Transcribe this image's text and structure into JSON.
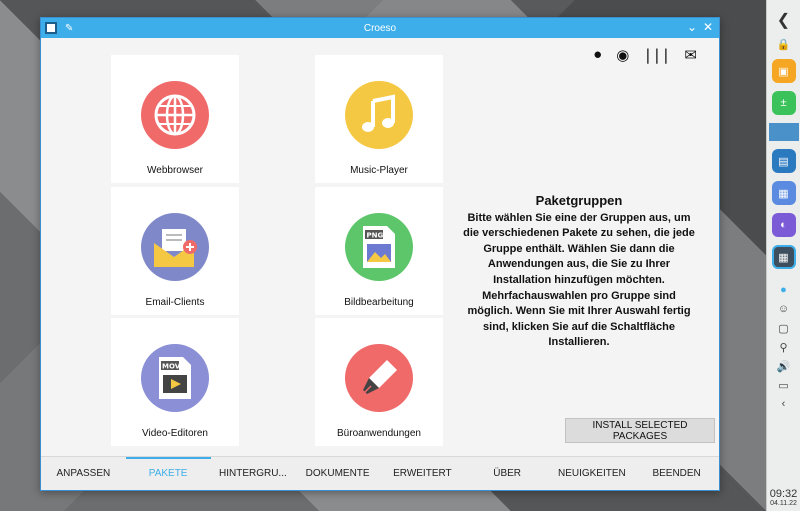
{
  "window": {
    "title": "Croeso"
  },
  "header_icons": [
    "github-icon",
    "chat-icon",
    "kde-icon",
    "mail-icon"
  ],
  "tiles": [
    {
      "label": "Webbrowser",
      "icon": "globe-icon",
      "color": "#f06a6a"
    },
    {
      "label": "Music-Player",
      "icon": "music-note-icon",
      "color": "#f4c842"
    },
    {
      "label": "Email-Clients",
      "icon": "email-envelope-icon",
      "color": "#7f89c9"
    },
    {
      "label": "Bildbearbeitung",
      "icon": "png-file-icon",
      "color": "#5dc66b"
    },
    {
      "label": "Video-Editoren",
      "icon": "mov-file-icon",
      "color": "#8a8fd6"
    },
    {
      "label": "Büroanwendungen",
      "icon": "fountain-pen-icon",
      "color": "#f06a6a"
    }
  ],
  "info": {
    "heading": "Paketgruppen",
    "body": "Bitte wählen Sie eine der Gruppen aus, um die verschiedenen Pakete zu sehen, die jede Gruppe enthält. Wählen Sie dann die Anwendungen aus, die Sie zu Ihrer Installation hinzufügen möchten. Mehrfachauswahlen pro Gruppe sind möglich. Wenn Sie mit Ihrer Auswahl fertig sind, klicken Sie auf die Schaltfläche Installieren."
  },
  "install_button": "INSTALL SELECTED PACKAGES",
  "tabs": [
    "ANPASSEN",
    "PAKETE",
    "HINTERGRU...",
    "DOKUMENTE",
    "ERWEITERT",
    "ÜBER",
    "NEUIGKEITEN",
    "BEENDEN"
  ],
  "active_tab": "PAKETE",
  "panel": {
    "time": "09:32",
    "date": "04.11.22"
  }
}
